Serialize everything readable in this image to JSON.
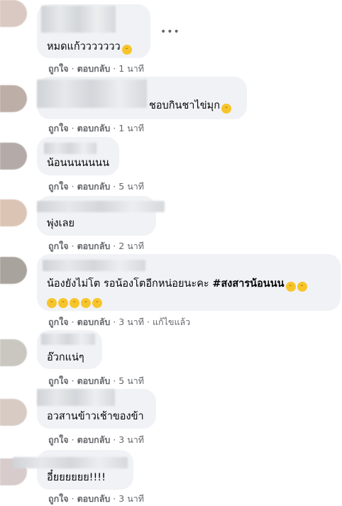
{
  "comments": [
    {
      "text": "หมดแก้ววววววว",
      "emoji": "😄",
      "time": "1 นาที"
    },
    {
      "text": "ชอบกินชาไข่มุก",
      "emoji": "😄",
      "time": "1 นาที"
    },
    {
      "text": "น้อนนนนนนน",
      "time": "5 นาที"
    },
    {
      "text": "พุ่งเลย",
      "time": "2 นาที"
    },
    {
      "text_plain": "น้องยังไม่โต รอน้องโตอีกหน่อยนะคะ ",
      "hashtag": "#สงสารน้อนนน",
      "emoji_line": "😂🤣🤣🤣🤣",
      "time": "3 นาที",
      "edited": "แก้ไขแล้ว"
    },
    {
      "text": "อ๊วกแน่ๆ",
      "time": "5 นาที"
    },
    {
      "text": "อวสานข้าวเช้าของข้า",
      "time": "3 นาที"
    },
    {
      "text": "อี๋ยยยยยย!!!!",
      "time": "3 นาที"
    }
  ],
  "actions": {
    "like": "ถูกใจ",
    "reply": "ตอบกลับ",
    "dot": "·"
  },
  "more_icon": "•••"
}
